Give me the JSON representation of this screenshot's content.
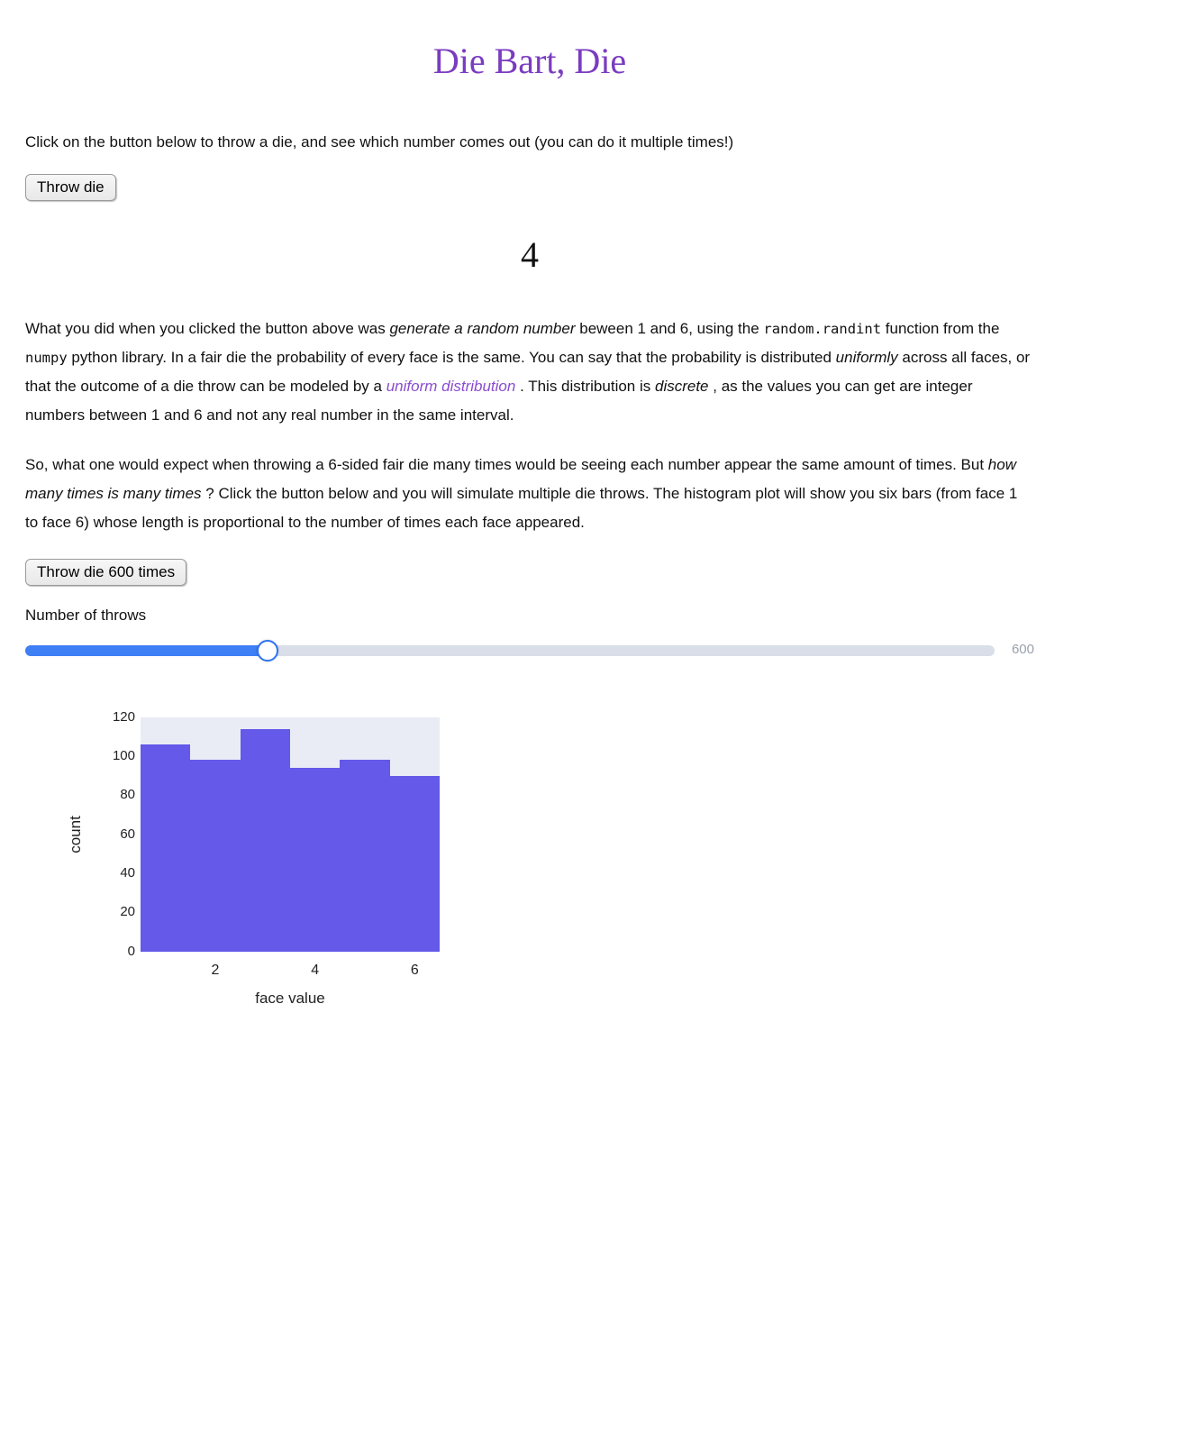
{
  "title": "Die Bart, Die",
  "intro": "Click on the button below to throw a die, and see which number comes out (you can do it multiple times!)",
  "throw_button_label": "Throw die",
  "throw_result": "4",
  "paragraph1": {
    "t1": "What you did when you clicked the button above was ",
    "em_generate": "generate a random number",
    "t2": " beween 1 and 6, using the ",
    "code_randint": "random.randint",
    "t3": " function from the ",
    "code_numpy": "numpy",
    "t4": " python library. In a fair die the probability of every face is the same. You can say that the probability is distributed ",
    "em_uniformly": "uniformly",
    "t5": " across all faces, or that the outcome of a die throw can be modeled by a ",
    "link_uniform": "uniform distribution",
    "t6": ". This distribution is ",
    "em_discrete": "discrete",
    "t7": ", as the values you can get are integer numbers between 1 and 6 and not any real number in the same interval."
  },
  "paragraph2": {
    "t1": "So, what one would expect when throwing a 6-sided fair die many times would be seeing each number appear the same amount of times. But ",
    "em_howmany": "how many times is many times",
    "t2": "? Click the button below and you will simulate multiple die throws. The histogram plot will show you six bars (from face 1 to face 6) whose length is proportional to the number of times each face appeared."
  },
  "throw_multi_button_label": "Throw die 600 times",
  "slider": {
    "label": "Number of throws",
    "value": 600,
    "value_text": "600",
    "fill_pct": 25
  },
  "chart_data": {
    "type": "bar",
    "categories": [
      1,
      2,
      3,
      4,
      5,
      6
    ],
    "values": [
      106,
      98,
      114,
      94,
      98,
      90
    ],
    "xlabel": "face value",
    "ylabel": "count",
    "ylim": [
      0,
      120
    ],
    "y_ticks": [
      0,
      20,
      40,
      60,
      80,
      100,
      120
    ],
    "x_ticks": [
      2,
      4,
      6
    ]
  }
}
